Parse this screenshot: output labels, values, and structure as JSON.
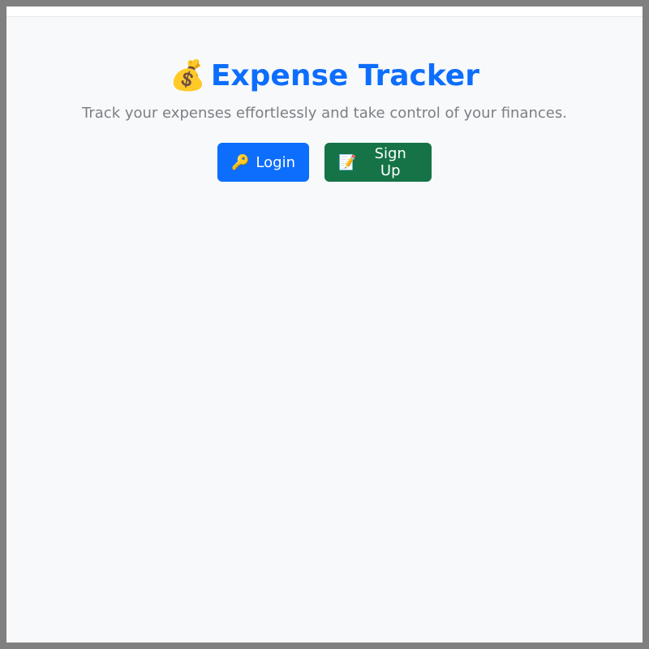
{
  "app": {
    "title_icon": "money-bag-icon",
    "title_emoji": "💰",
    "title": "Expense Tracker",
    "subtitle": "Track your expenses effortlessly and take control of your finances."
  },
  "actions": {
    "login": {
      "icon": "key-icon",
      "emoji": "🔑",
      "label": "Login"
    },
    "signup": {
      "icon": "memo-icon",
      "emoji": "📝",
      "label": "Sign Up"
    }
  },
  "colors": {
    "primary": "#0d6efd",
    "success": "#157347",
    "background": "#f8f9fa",
    "muted_text": "#7a7f86"
  }
}
